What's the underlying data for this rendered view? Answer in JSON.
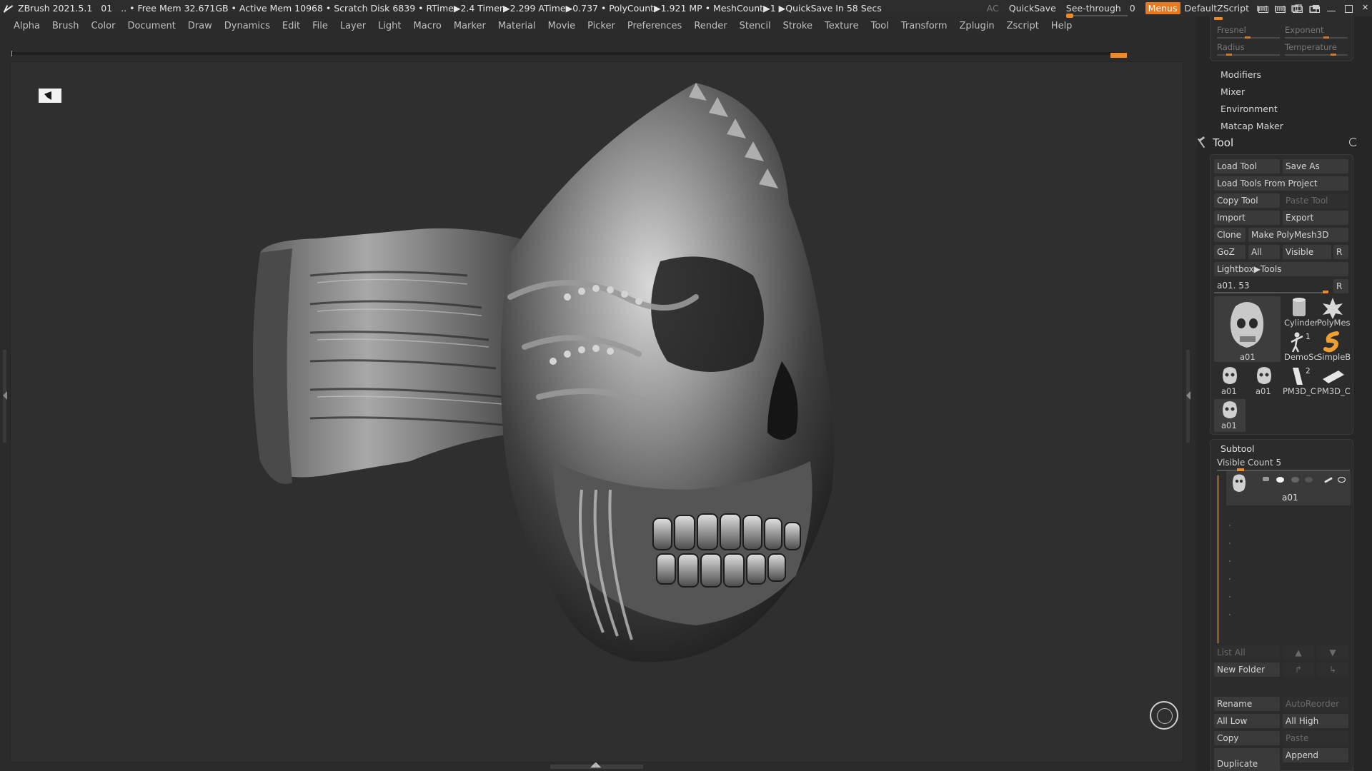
{
  "titlebar": {
    "app": "ZBrush 2021.5.1",
    "doc_index": "01",
    "stats": ".. • Free Mem 32.671GB • Active Mem 10968 • Scratch Disk 6839 •  RTime▶2.4 Timer▶2.299 ATime▶0.737 • PolyCount▶1.921 MP  • MeshCount▶1  ▶QuickSave In 58 Secs",
    "ac": "AC",
    "quicksave": "QuickSave",
    "see_through_label": "See-through",
    "see_through_value": "0",
    "menus": "Menus",
    "default_zscript": "DefaultZScript"
  },
  "menubar": {
    "items": [
      "Alpha",
      "Brush",
      "Color",
      "Document",
      "Draw",
      "Dynamics",
      "Edit",
      "File",
      "Layer",
      "Light",
      "Macro",
      "Marker",
      "Material",
      "Movie",
      "Picker",
      "Preferences",
      "Render",
      "Stencil",
      "Stroke",
      "Texture",
      "Tool",
      "Transform",
      "Zplugin",
      "Zscript",
      "Help"
    ]
  },
  "light_panel": {
    "fresnel": "Fresnel",
    "exponent": "Exponent",
    "radius": "Radius",
    "temperature": "Temperature"
  },
  "tray_links": [
    "Modifiers",
    "Mixer",
    "Environment",
    "Matcap Maker"
  ],
  "tool": {
    "title": "Tool",
    "load_tool": "Load Tool",
    "save_as": "Save As",
    "load_tools_from_project": "Load Tools From Project",
    "copy_tool": "Copy Tool",
    "paste_tool": "Paste Tool",
    "import": "Import",
    "export": "Export",
    "clone": "Clone",
    "make_polymesh3d": "Make PolyMesh3D",
    "goz": "GoZ",
    "all": "All",
    "visible": "Visible",
    "r": "R",
    "lightbox_tools": "Lightbox▶Tools",
    "current_tool": "a01. 53",
    "current_r": "R",
    "thumbs": {
      "main": "a01",
      "cylinder": "Cylinder",
      "polymesh": "PolyMes",
      "demosoldier": "DemoSc",
      "demosoldier_badge": "1",
      "simplebrush": "SimpleB",
      "a01_1": "a01",
      "a01_2": "a01",
      "pm3d_1": "PM3D_C",
      "pm3d_1_badge": "2",
      "pm3d_2": "PM3D_C",
      "a01_3": "a01"
    }
  },
  "subtool": {
    "title": "Subtool",
    "visible_count": "Visible Count 5",
    "row_name": "a01",
    "list_all": "List All",
    "new_folder": "New Folder",
    "rename": "Rename",
    "auto_reorder": "AutoReorder",
    "all_low": "All Low",
    "all_high": "All High",
    "copy": "Copy",
    "paste": "Paste",
    "duplicate": "Duplicate",
    "append": "Append"
  },
  "colors": {
    "accent": "#f08a24",
    "background": "#2b2b2b",
    "canvas": "#2f2f2f",
    "panel": "#2c2c2c",
    "button": "#3a3a3a"
  }
}
